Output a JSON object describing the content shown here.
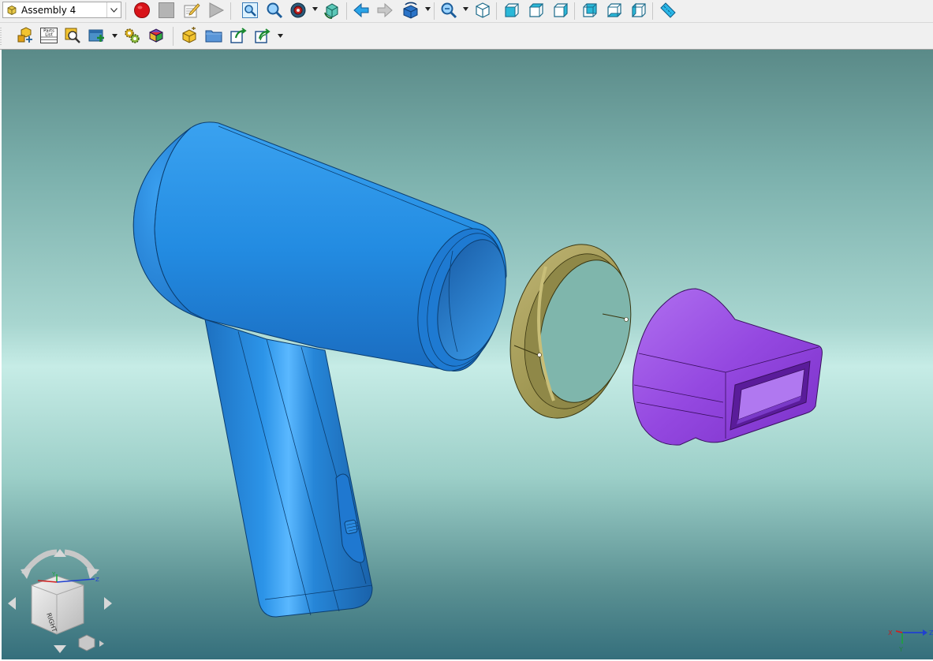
{
  "toolbar": {
    "assembly_select": {
      "value": "Assembly 4",
      "icon": "assembly-icon"
    },
    "row1_icons": [
      "record-icon",
      "stop-icon",
      "edit-macro-icon",
      "play-icon",
      "zoom-fit-icon",
      "zoom-icon",
      "display-mode-icon",
      "rotate-view-icon",
      "previous-view-icon",
      "next-view-icon",
      "view-orientation-icon",
      "zoom-window-icon",
      "iso-view-icon",
      "front-view-icon",
      "top-view-icon",
      "right-view-icon",
      "back-view-icon",
      "bottom-view-icon",
      "left-view-icon",
      "measure-icon"
    ],
    "row2_icons": [
      "insert-part-icon",
      "parts-list-icon",
      "inspect-icon",
      "add-component-icon",
      "properties-icon",
      "color-icon",
      "new-part-icon",
      "open-folder-icon",
      "export-icon",
      "share-icon"
    ],
    "parts_list_label_line1": "Parts",
    "parts_list_label_line2": "List"
  },
  "viewcube": {
    "face_label": "RIGHT",
    "axis_labels": {
      "y": "Y",
      "z": "Z"
    }
  },
  "triad": {
    "x": "X",
    "y": "Y",
    "z": "Z"
  },
  "colors": {
    "housing": "#2a8ad8",
    "ring": "#a8a05a",
    "nozzle": "#9a4de0",
    "background_top": "#5a8a88",
    "background_mid": "#c6ece6",
    "background_bottom": "#356f7c"
  }
}
